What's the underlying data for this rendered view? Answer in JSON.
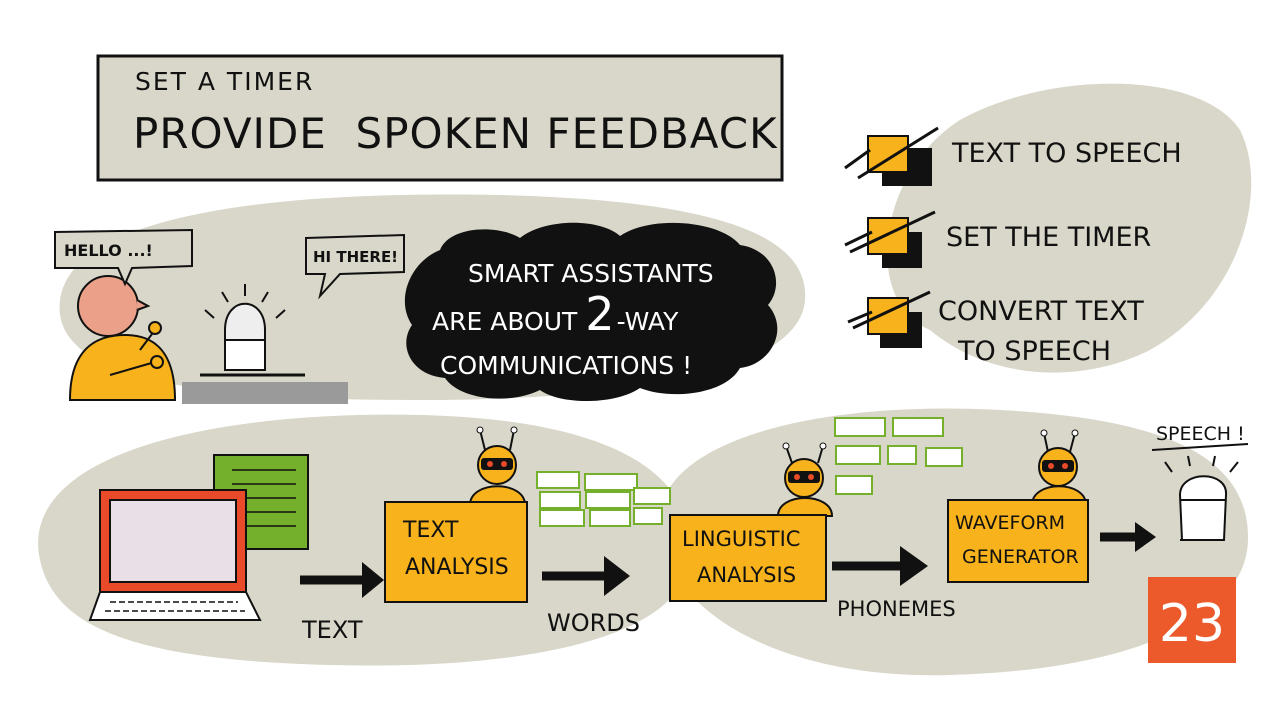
{
  "title_box": {
    "subtitle": "SET A TIMER",
    "title": "PROVIDE  SPOKEN FEEDBACK"
  },
  "checklist": [
    {
      "label_lines": [
        "TEXT TO SPEECH"
      ]
    },
    {
      "label_lines": [
        "SET THE TIMER"
      ]
    },
    {
      "label_lines": [
        "CONVERT TEXT",
        "TO SPEECH"
      ]
    }
  ],
  "conversation": {
    "person_bubble": "HELLO ...!",
    "speaker_bubble": "HI THERE!"
  },
  "cloud": {
    "line1": "SMART ASSISTANTS",
    "line2a": "ARE ABOUT",
    "line2b": "2",
    "line2c": "-WAY",
    "line3": "COMMUNICATIONS !"
  },
  "pipeline": {
    "box_text_analysis": [
      "TEXT",
      "ANALYSIS"
    ],
    "box_linguistic": [
      "LINGUISTIC",
      "ANALYSIS"
    ],
    "box_waveform": [
      "WAVEFORM",
      "GENERATOR"
    ],
    "label_text": "TEXT",
    "label_words": "WORDS",
    "label_phonemes": "PHONEMES",
    "label_speech": "SPEECH !"
  },
  "lesson_number": "23",
  "colors": {
    "blob": "#d9d7c9",
    "orange": "#f7b21c",
    "red": "#e84a2a",
    "green": "#74b02b",
    "badge": "#ec5a2c",
    "cloud": "#111111"
  }
}
